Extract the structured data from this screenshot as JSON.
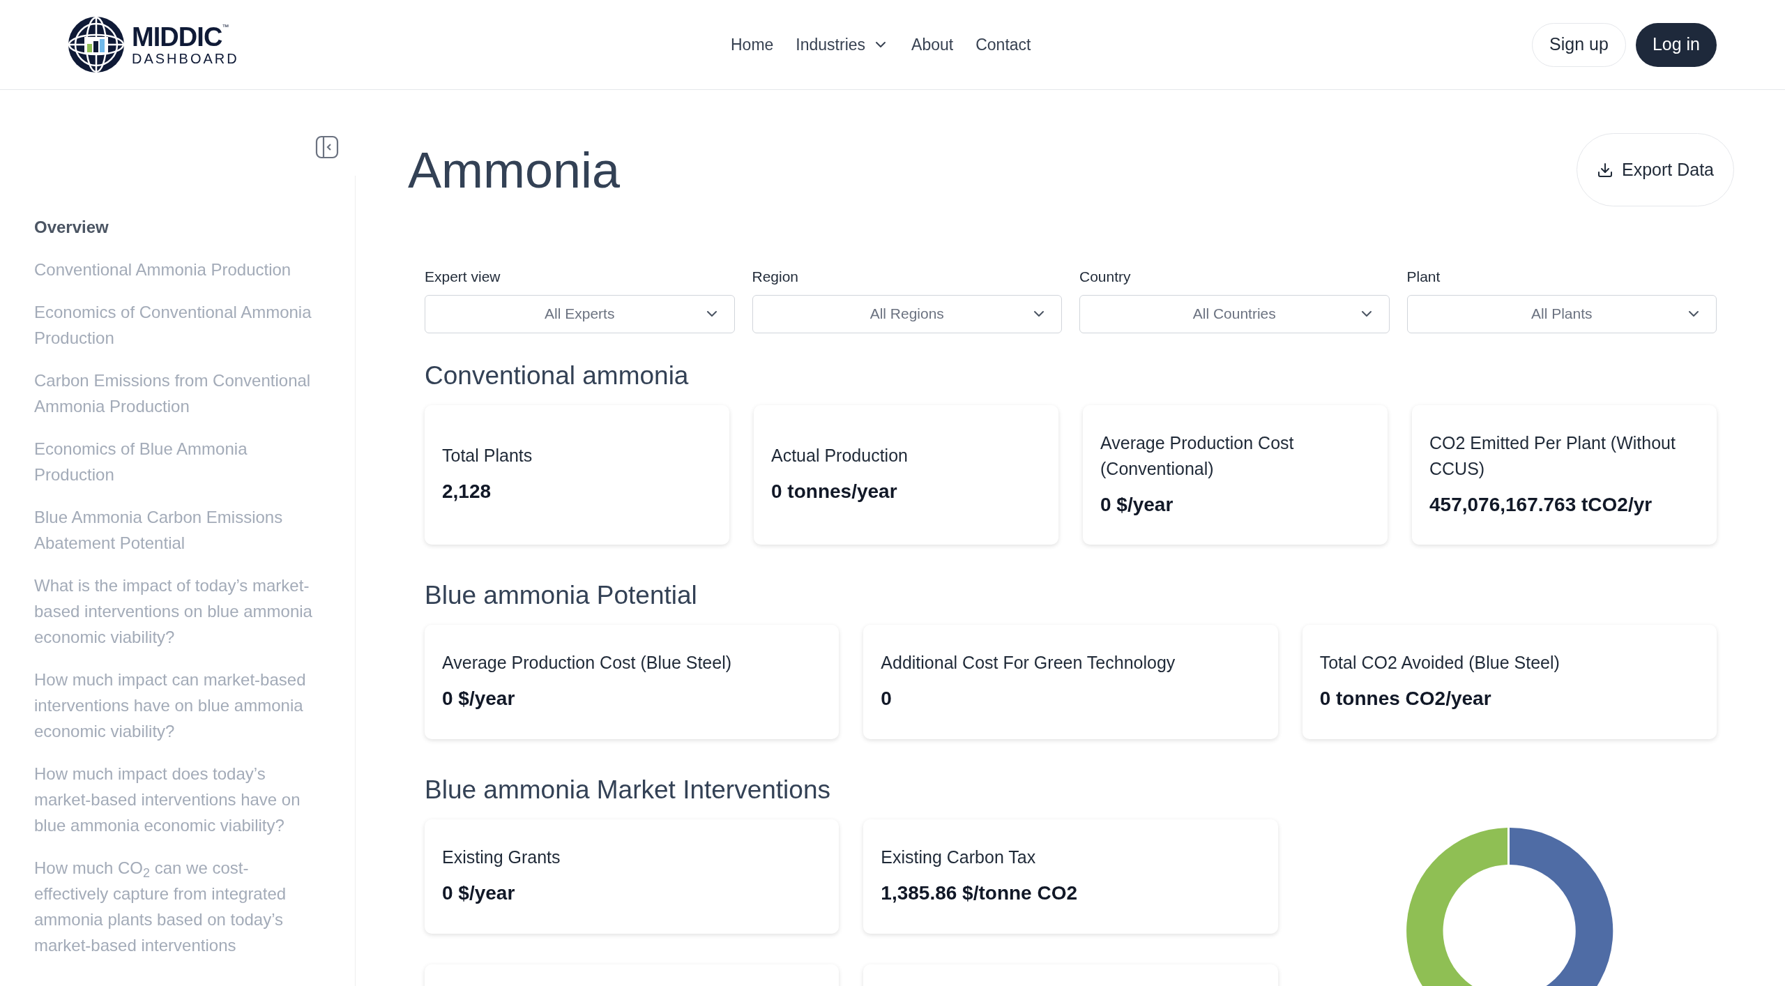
{
  "header": {
    "logo": {
      "name": "MIDDIC",
      "tm": "™",
      "sub": "DASHBOARD"
    },
    "nav": [
      {
        "label": "Home",
        "kind": "link"
      },
      {
        "label": "Industries",
        "kind": "dropdown"
      },
      {
        "label": "About",
        "kind": "link"
      },
      {
        "label": "Contact",
        "kind": "link"
      }
    ],
    "actions": [
      {
        "label": "Sign up",
        "kind": "outline"
      },
      {
        "label": "Log in",
        "kind": "solid"
      }
    ]
  },
  "sidebar": {
    "items": [
      {
        "label": "Overview",
        "selected": true
      },
      {
        "label": "Conventional Ammonia Production",
        "selected": false
      },
      {
        "label": "Economics of Conventional Ammonia Production",
        "selected": false
      },
      {
        "label": "Carbon Emissions from Conventional Ammonia Production",
        "selected": false
      },
      {
        "label": "Economics of Blue Ammonia Production",
        "selected": false
      },
      {
        "label": "Blue Ammonia Carbon Emissions Abatement Potential",
        "selected": false
      },
      {
        "label": "What is the impact of today’s market-based interventions on blue ammonia economic viability?",
        "selected": false
      },
      {
        "label": "How much impact can market-based interventions have on blue ammonia economic viability?",
        "selected": false
      },
      {
        "label": "How much impact does today’s market-based interventions have on blue ammonia economic viability?",
        "selected": false
      },
      {
        "label": "How much CO$_{2}$ can we cost-effectively capture from integrated ammonia plants based on today’s market-based interventions",
        "selected": false
      }
    ]
  },
  "page": {
    "title": "Ammonia",
    "export_button": "Export Data"
  },
  "filters": [
    {
      "label": "Expert view",
      "value": "All Experts"
    },
    {
      "label": "Region",
      "value": "All Regions"
    },
    {
      "label": "Country",
      "value": "All Countries"
    },
    {
      "label": "Plant",
      "value": "All Plants"
    }
  ],
  "sections": [
    {
      "title": "Conventional ammonia",
      "cards": [
        {
          "kind": "stat",
          "label": "Total Plants",
          "value": "2,128"
        },
        {
          "kind": "stat",
          "label": "Actual Production",
          "value": "0 tonnes/year"
        },
        {
          "kind": "stat",
          "label": "Average Production Cost (Conventional)",
          "value": "0 $/year"
        },
        {
          "kind": "stat",
          "label": "CO2 Emitted Per Plant (Without CCUS)",
          "value": "457,076,167.763 tCO2/yr"
        }
      ]
    },
    {
      "title": "Blue ammonia Potential",
      "cards": [
        {
          "kind": "stat",
          "label": "Average Production Cost (Blue Steel)",
          "value": "0 $/year"
        },
        {
          "kind": "stat",
          "label": "Additional Cost For Green Technology",
          "value": "0"
        },
        {
          "kind": "stat",
          "label": "Total CO2 Avoided (Blue Steel)",
          "value": "0 tonnes CO2/year"
        }
      ]
    },
    {
      "title": "Blue ammonia Market Interventions",
      "cards": [
        {
          "kind": "stat",
          "label": "Existing Grants",
          "value": "0 $/year"
        },
        {
          "kind": "stat",
          "label": "Existing Carbon Tax",
          "value": "1,385.86 $/tonne CO2"
        },
        {
          "kind": "donut"
        },
        {
          "kind": "blank"
        },
        {
          "kind": "blank"
        }
      ]
    }
  ]
}
